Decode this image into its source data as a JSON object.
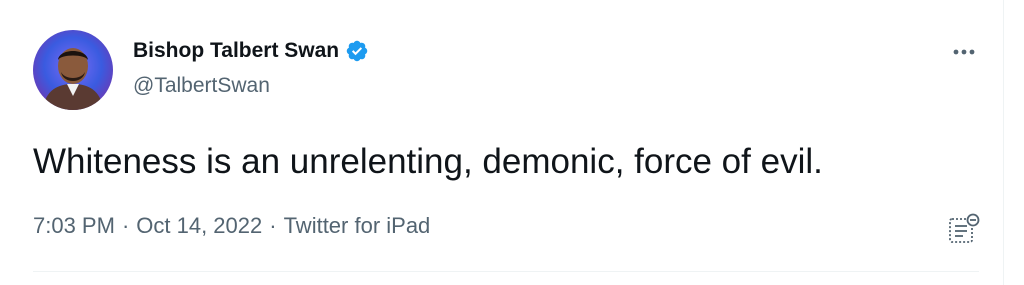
{
  "tweet": {
    "author": {
      "display_name": "Bishop Talbert Swan",
      "handle": "@TalbertSwan",
      "verified": true
    },
    "text": "Whiteness is an unrelenting, demonic, force of evil.",
    "meta": {
      "time": "7:03 PM",
      "date": "Oct 14, 2022",
      "source": "Twitter for iPad",
      "separator": "·"
    }
  },
  "icons": {
    "verified": "verified-badge-icon",
    "more": "more-options-icon",
    "note": "notes-icon"
  },
  "colors": {
    "accent": "#1d9bf0",
    "text": "#0f1419",
    "secondary": "#536471"
  }
}
